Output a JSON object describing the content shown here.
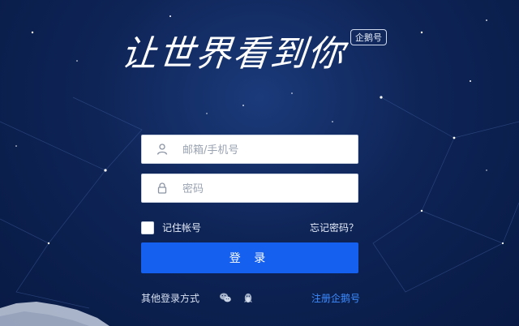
{
  "header": {
    "slogan": "让世界看到你",
    "badge": "企鹅号"
  },
  "form": {
    "account_placeholder": "邮箱/手机号",
    "password_placeholder": "密码",
    "remember_label": "记住帐号",
    "forgot_link": "忘记密码？",
    "login_button": "登 录"
  },
  "footer": {
    "other_login_label": "其他登录方式",
    "register_link": "注册企鹅号"
  },
  "colors": {
    "background": "#0e2456",
    "accent": "#1660f0",
    "link": "#3d8cff"
  }
}
